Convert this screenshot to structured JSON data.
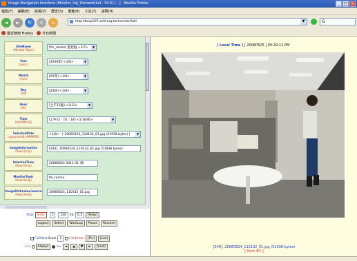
{
  "window": {
    "title": "Image Navigation Interface (Monitor_log_Demand(full - 54.0) [...] - Mozilla Firefox"
  },
  "menu": [
    "檔案(F)",
    "編輯(E)",
    "檢視(V)",
    "歷史(S)",
    "書籤(B)",
    "工具(T)",
    "說明(H)"
  ],
  "url": "http://boop007.acl4.org.tw/monitor/full/",
  "search": {
    "value": "G"
  },
  "bookmarks": [
    "最近使用 Firefox",
    "今日新聞"
  ],
  "fields": [
    {
      "label": "SiteName",
      "sub": "(Monitor Topic)",
      "value": "[fin_rooms] 監控點 <3/7>"
    },
    {
      "label": "Year",
      "sub": "[year]",
      "value": "[2006年] <1/8>"
    },
    {
      "label": "Month",
      "sub": "[mm]",
      "value": "[05月] <1/8>"
    },
    {
      "label": "Day",
      "sub": "[dd]",
      "value": "[24日] <1/8>"
    },
    {
      "label": "Hour",
      "sub": "[hh]",
      "value": "[上午11點] <3/13>"
    },
    {
      "label": "Time",
      "sub": "[HH:MM:SS]",
      "value": "[上午11 : 01 : 18] <1/1836>"
    },
    {
      "label": "SelectedDate",
      "sub": "(yyyymmdd_HHMMSS)",
      "value": "<1/8> - [ 20060524_110132_01.jpg (51938 bytes) ]"
    },
    {
      "label": "ImageInformation",
      "sub": "(Read Only)",
      "value": "[240]. 20060524_110132_01.jpg (51938 bytes)"
    },
    {
      "label": "SelectedTime",
      "sub": "(Read Only)",
      "value": "20060524 0011 01 38"
    },
    {
      "label": "MonitorTopic",
      "sub": "(Read Only)",
      "value": "fin_rooms"
    },
    {
      "label": "ImagePathname/source",
      "sub": "(Read Only)",
      "value": "20060524_110132_01.jpg"
    }
  ],
  "controls": {
    "total_label": "Total",
    "slide_label": "Slide",
    "slide_value": "1",
    "of_value": "240",
    "int_label": "Int",
    "int_value": "0.5",
    "help_label": "[Help]",
    "row2": [
      "Logout",
      "Select",
      "WorkLog",
      "Pause",
      "Resume"
    ],
    "fullview_label": "FullView",
    "scale_label": "Scale",
    "scale_value": "1",
    "coldview_label": "ColdView",
    "pic_label": "[Pic]",
    "list_label": "[List]",
    "nav_prefix": "<<",
    "always_label": "Always",
    "nav_next": ">>",
    "nav_arrows": [
      "◄",
      "▲",
      "▼",
      "►"
    ],
    "last_label": "[Last]"
  },
  "image_panel": {
    "localtime_label": "( Local Time )",
    "localtime_value": "[ 20060525 ] 05:32:11 PM",
    "caption": "[240]. 20060524_110132_01.jpg (51938 bytes)",
    "caption_sub": "[ Item #1 ]"
  }
}
